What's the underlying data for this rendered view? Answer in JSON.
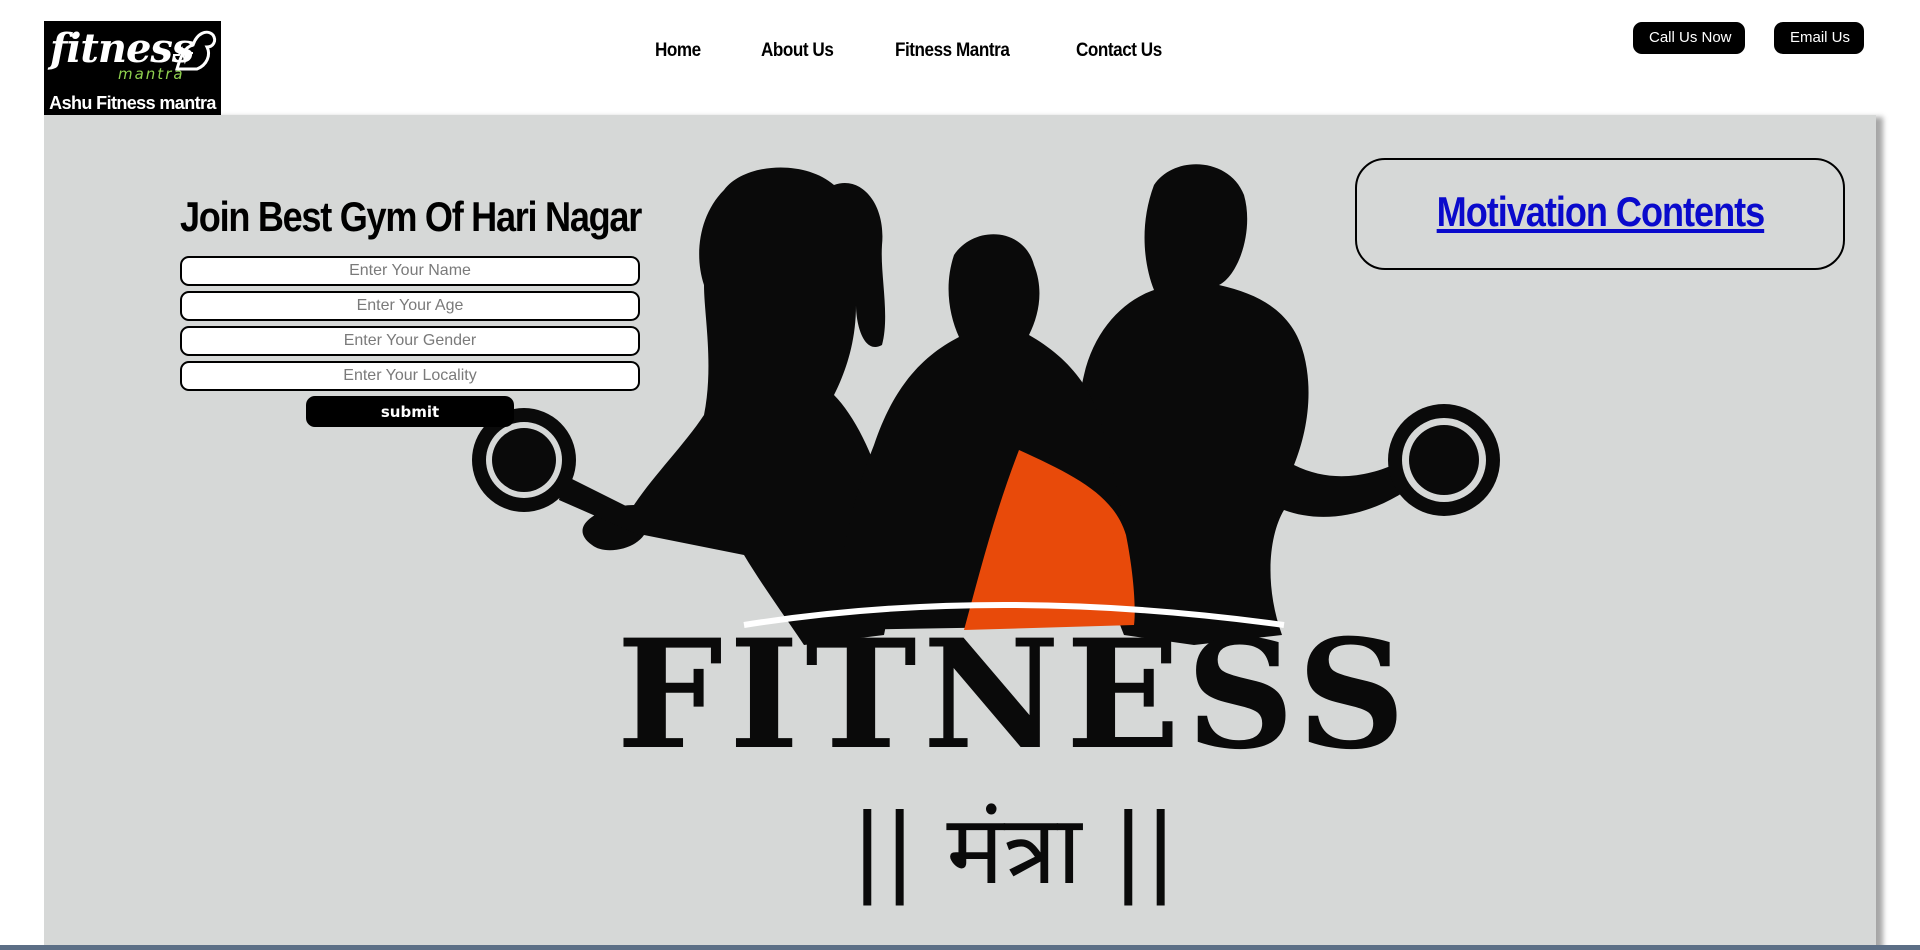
{
  "brand": {
    "logo_word": "fitness",
    "logo_sub": "mantra",
    "caption": "Ashu Fitness mantra"
  },
  "nav": {
    "items": [
      "Home",
      "About Us",
      "Fitness Mantra",
      "Contact Us"
    ]
  },
  "actions": {
    "call": "Call Us Now",
    "email": "Email Us"
  },
  "hero": {
    "join_title": "Join Best Gym Of Hari Nagar",
    "form": {
      "name_placeholder": "Enter Your Name",
      "age_placeholder": "Enter Your Age",
      "gender_placeholder": "Enter Your Gender",
      "locality_placeholder": "Enter Your Locality",
      "submit_label": "submit"
    },
    "motivation_link": "Motivation Contents",
    "artwork": {
      "word": "FITNESS",
      "subword": "|| मंत्रा ||",
      "background_color": "#d6d8d7",
      "accent_color": "#e84a0a",
      "silhouette_color": "#0a0a0a"
    }
  }
}
